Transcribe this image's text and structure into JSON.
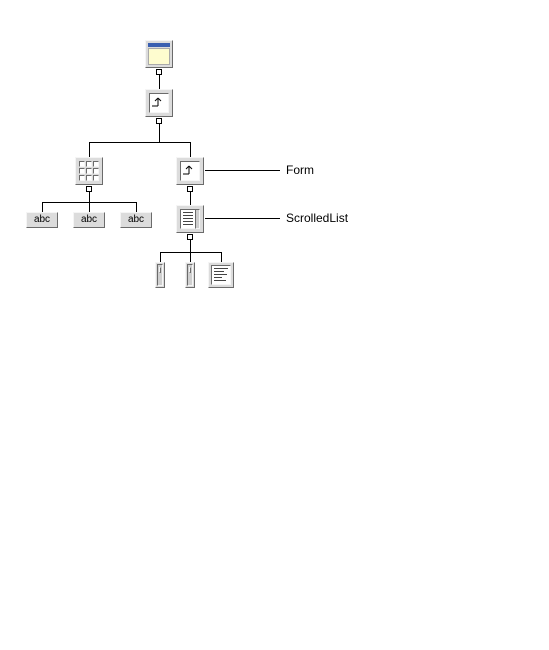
{
  "labels": {
    "form": "Form",
    "scrolledlist": "ScrolledList"
  },
  "buttons": {
    "abc1": "abc",
    "abc2": "abc",
    "abc3": "abc"
  },
  "icons": {
    "window": "window-icon",
    "form": "form-icon",
    "grid": "grid-icon",
    "scrolledlist": "scrolled-list-icon",
    "scrollbar": "scrollbar-icon",
    "textpanel": "textpanel-icon"
  }
}
